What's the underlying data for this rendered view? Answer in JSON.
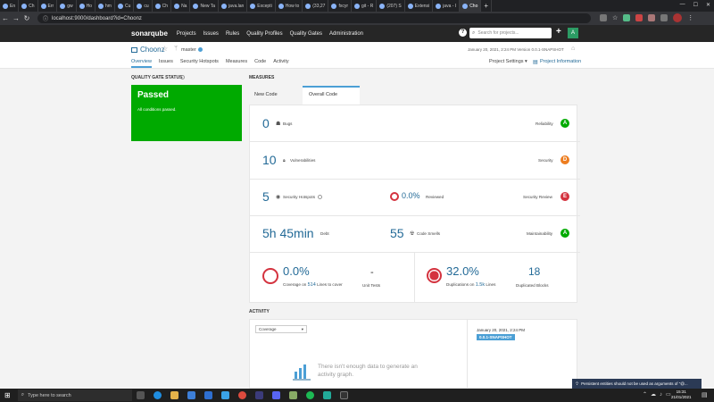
{
  "browser": {
    "tabs": [
      "En",
      "Ch",
      "Err",
      "gw",
      "Ho",
      "hm",
      "Cu",
      "cu",
      "Ch",
      "Na",
      "New Ta",
      "java.lan",
      "Excepti",
      "How to",
      "(33,27",
      "fxcyr",
      "git - R",
      "(207) S",
      "Extensi",
      "java - I",
      "Cho"
    ],
    "url": "localhost:9000/dashboard?id=Choonz"
  },
  "sonar_nav": {
    "logo": "sonarqube",
    "items": [
      "Projects",
      "Issues",
      "Rules",
      "Quality Profiles",
      "Quality Gates",
      "Administration"
    ],
    "search_placeholder": "Search for projects...",
    "avatar_letter": "A"
  },
  "project": {
    "name": "Choonz",
    "branch": "master",
    "meta": "January 20, 2021, 2:24 PM  Version 0.0.1-SNAPSHOT",
    "tabs": [
      "Overview",
      "Issues",
      "Security Hotspots",
      "Measures",
      "Code",
      "Activity"
    ],
    "settings": "Project Settings ▾",
    "info": "Project Information"
  },
  "quality_gate": {
    "heading": "QUALITY GATE STATUS",
    "status": "Passed",
    "message": "All conditions passed."
  },
  "measures": {
    "heading": "MEASURES",
    "tab_new": "New Code",
    "tab_overall": "Overall Code",
    "bugs": {
      "value": "0",
      "label": "Bugs",
      "rating_label": "Reliability",
      "rating": "A"
    },
    "vulns": {
      "value": "10",
      "label": "Vulnerabilities",
      "rating_label": "Security",
      "rating": "D"
    },
    "hotspots": {
      "value": "5",
      "label": "Security Hotspots",
      "reviewed": "0.0%",
      "reviewed_label": "Reviewed",
      "rating_label": "Security Review",
      "rating": "E"
    },
    "debt": {
      "value": "5h 45min",
      "label": "Debt",
      "smells": "55",
      "smells_label": "Code Smells",
      "rating_label": "Maintainability",
      "rating": "A"
    },
    "coverage": {
      "value": "0.0%",
      "label_pre": "Coverage on",
      "lines": "514",
      "label_post": "Lines to cover",
      "unit_tests": "-",
      "unit_tests_label": "Unit Tests"
    },
    "duplications": {
      "value": "32.0%",
      "label_pre": "Duplications on",
      "lines": "1.5k",
      "label_post": "Lines",
      "blocks": "18",
      "blocks_label": "Duplicated Blocks"
    }
  },
  "activity": {
    "heading": "ACTIVITY",
    "select": "Coverage",
    "empty": "There isn't enough data to generate an activity graph.",
    "event_date": "January 20, 2021, 2:24 PM",
    "event_badge": "0.0.1-SNAPSHOT"
  },
  "toast": "Persistent entities should not be used as arguments of \"@...",
  "taskbar": {
    "search": "Type here to search",
    "time": "15:31",
    "date": "21/01/2021"
  },
  "colors": {
    "passed": "#00aa00",
    "rating_a": "#00aa00",
    "rating_d": "#ed7d20",
    "rating_e": "#d4333f",
    "value": "#236a97"
  }
}
